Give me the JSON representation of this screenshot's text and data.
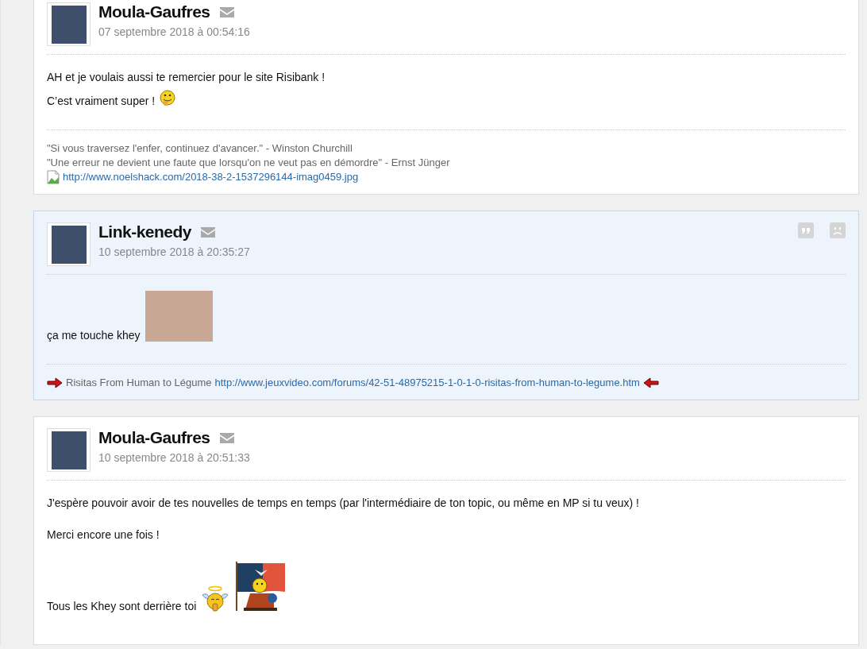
{
  "posts": [
    {
      "author": "Moula-Gaufres",
      "date": "07 septembre 2018 à 00:54:16",
      "highlighted": false,
      "body": [
        {
          "kind": "line",
          "text": "AH et je voulais aussi te remercier pour le site Risibank !"
        },
        {
          "kind": "line",
          "text": "C’est vraiment super !",
          "stickers": [
            {
              "kind": "smiley"
            }
          ]
        }
      ],
      "signature": [
        [
          {
            "kind": "text",
            "text": "\"Si vous traversez l'enfer, continuez d'avancer.\" - Winston Churchill"
          }
        ],
        [
          {
            "kind": "text",
            "text": "\"Une erreur ne devient une faute que lorsqu'on ne veut pas en démordre\" - Ernst Jünger"
          }
        ],
        [
          {
            "kind": "broken-image"
          },
          {
            "kind": "link",
            "text": "http://www.noelshack.com/2018-38-2-1537296144-imag0459.jpg"
          }
        ]
      ]
    },
    {
      "author": "Link-kenedy",
      "date": "10 septembre 2018 à 20:35:27",
      "highlighted": true,
      "body": [
        {
          "kind": "line",
          "text": "ça me touche khey",
          "stickers": [
            {
              "kind": "photo"
            }
          ]
        }
      ],
      "signature": [
        [
          {
            "kind": "arrow-right"
          },
          {
            "kind": "text",
            "text": "Risitas From Human to Légume"
          },
          {
            "kind": "link",
            "text": "http://www.jeuxvideo.com/forums/42-51-48975215-1-0-1-0-risitas-from-human-to-legume.htm"
          },
          {
            "kind": "arrow-left"
          }
        ]
      ]
    },
    {
      "author": "Moula-Gaufres",
      "date": "10 septembre 2018 à 20:51:33",
      "highlighted": false,
      "body": [
        {
          "kind": "paragraph",
          "text": "J'espère pouvoir avoir de tes nouvelles de temps en temps (par l'intermédiaire de ton topic, ou même en MP si tu veux) !"
        },
        {
          "kind": "paragraph",
          "text": "Merci encore une fois !"
        },
        {
          "kind": "paragraph",
          "text": "Tous les Khey sont derrière toi",
          "stickers": [
            {
              "kind": "angel"
            },
            {
              "kind": "flag"
            }
          ]
        }
      ]
    }
  ]
}
